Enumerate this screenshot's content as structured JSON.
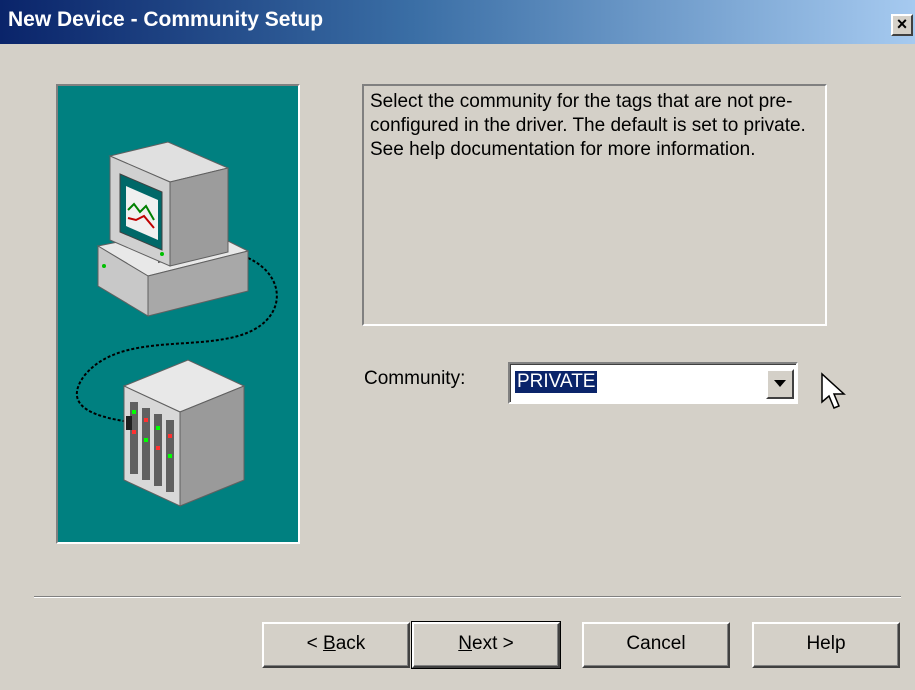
{
  "window": {
    "title": "New Device - Community Setup",
    "close_glyph": "×"
  },
  "description": "Select the community for the tags that are not pre-configured in the driver. The default is set to private. See help documentation for more information.",
  "community": {
    "label": "Community:",
    "value": "PRIVATE"
  },
  "buttons": {
    "back": {
      "prefix": "< ",
      "accel": "B",
      "rest": "ack"
    },
    "next": {
      "accel": "N",
      "rest": "ext >"
    },
    "cancel": "Cancel",
    "help": "Help"
  },
  "colors": {
    "panel_background": "#008080",
    "dialog_background": "#d4d0c8",
    "selection": "#0a246a",
    "titlebar_start": "#0a246a"
  },
  "icons": [
    "computer-icon",
    "network-device-icon",
    "dropdown-arrow-icon",
    "mouse-cursor-icon",
    "close-icon"
  ]
}
